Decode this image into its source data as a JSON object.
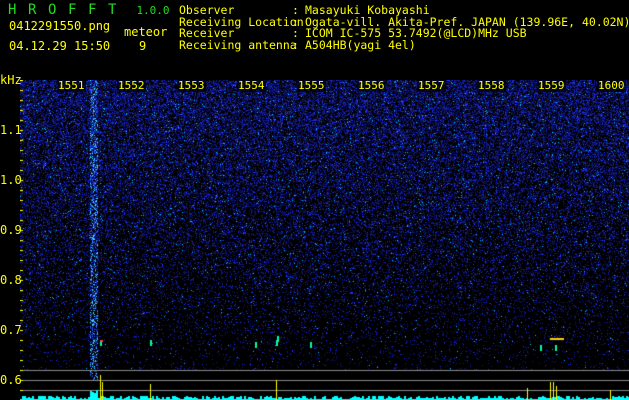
{
  "app": {
    "name_letters": [
      "H",
      "R",
      "O",
      "F",
      "F",
      "T"
    ],
    "version": "1.0.0"
  },
  "file": {
    "name": "0412291550.png",
    "datetime": "04.12.29 15:50"
  },
  "count": {
    "label": "meteor",
    "value": "9"
  },
  "info": [
    {
      "label": "Observer",
      "value": "Masayuki Kobayashi"
    },
    {
      "label": "Receiving Location",
      "value": "Ogata-vill. Akita-Pref. JAPAN (139.96E, 40.02N)"
    },
    {
      "label": "Receiver",
      "value": "ICOM IC-575 53.7492(@LCD)MHz USB"
    },
    {
      "label": "Receiving antenna",
      "value": "A504HB(yagi 4el)"
    }
  ],
  "axis": {
    "y_unit": "kHz",
    "y_ticks": [
      "1.1",
      "1.0",
      "0.9",
      "0.8",
      "0.7",
      "0.6"
    ],
    "x_ticks": [
      "1551",
      "1552",
      "1553",
      "1554",
      "1555",
      "1556",
      "1557",
      "1558",
      "1559",
      "1600"
    ]
  },
  "colors": {
    "text": "#ffff00",
    "logo": "#22dd22",
    "level": "#00ffff",
    "meteor": "#ffff00"
  }
}
